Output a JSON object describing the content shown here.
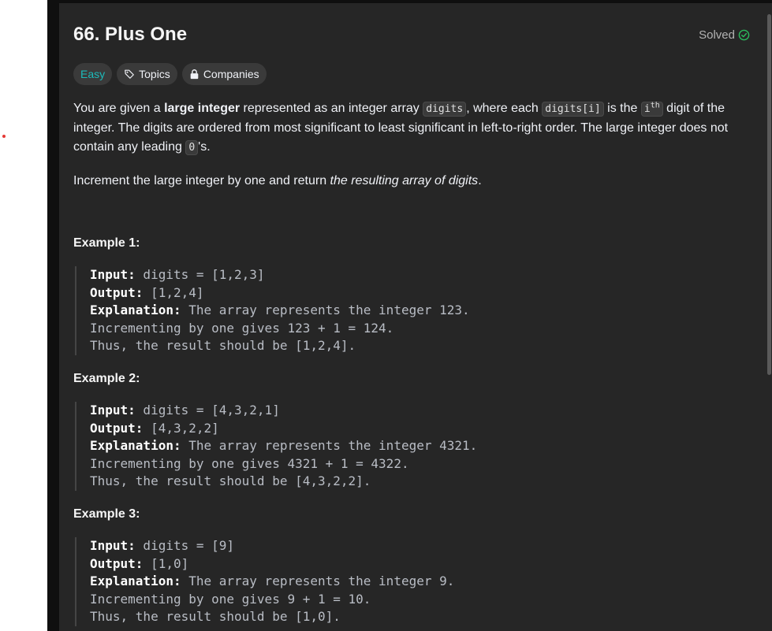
{
  "problem": {
    "title": "66. Plus One",
    "status": "Solved",
    "tags": [
      {
        "label": "Easy"
      },
      {
        "label": "Topics"
      },
      {
        "label": "Companies"
      }
    ],
    "colors": {
      "easy": "#1cbaba",
      "solved_check": "#2cbb5d",
      "panel_bg": "#262626"
    }
  },
  "description": {
    "p1": {
      "t1": "You are given a ",
      "bold1": "large integer",
      "t2": " represented as an integer array ",
      "code1": "digits",
      "t3": ", where each ",
      "code2": "digits[i]",
      "t4": " is the ",
      "code3_base": "i",
      "code3_sup": "th",
      "t5": " digit of the integer. The digits are ordered from most significant to least significant in left-to-right order. The large integer does not contain any leading ",
      "code4": "0",
      "t6": "'s."
    },
    "p2": {
      "t1": "Increment the large integer by one and return ",
      "em": "the resulting array of digits",
      "t2": "."
    }
  },
  "examples": [
    {
      "title": "Example 1:",
      "input_label": "Input:",
      "input": " digits = [1,2,3]",
      "output_label": "Output:",
      "output": " [1,2,4]",
      "explanation_label": "Explanation:",
      "explanation": " The array represents the integer 123.",
      "line4": "Incrementing by one gives 123 + 1 = 124.",
      "line5": "Thus, the result should be [1,2,4]."
    },
    {
      "title": "Example 2:",
      "input_label": "Input:",
      "input": " digits = [4,3,2,1]",
      "output_label": "Output:",
      "output": " [4,3,2,2]",
      "explanation_label": "Explanation:",
      "explanation": " The array represents the integer 4321.",
      "line4": "Incrementing by one gives 4321 + 1 = 4322.",
      "line5": "Thus, the result should be [4,3,2,2]."
    },
    {
      "title": "Example 3:",
      "input_label": "Input:",
      "input": " digits = [9]",
      "output_label": "Output:",
      "output": " [1,0]",
      "explanation_label": "Explanation:",
      "explanation": " The array represents the integer 9.",
      "line4": "Incrementing by one gives 9 + 1 = 10.",
      "line5": "Thus, the result should be [1,0]."
    }
  ]
}
